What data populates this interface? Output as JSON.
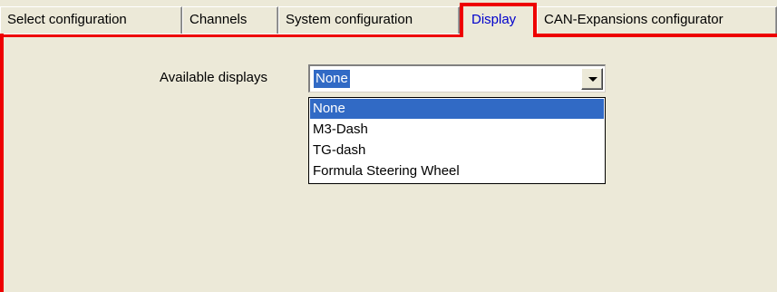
{
  "tabs": [
    {
      "label": "Select configuration",
      "active": false
    },
    {
      "label": "Channels",
      "active": false
    },
    {
      "label": "System configuration",
      "active": false
    },
    {
      "label": "Display",
      "active": true
    },
    {
      "label": "CAN-Expansions configurator",
      "active": false
    }
  ],
  "display_page": {
    "label": "Available displays",
    "select": {
      "value": "None",
      "options": [
        "None",
        "M3-Dash",
        "TG-dash",
        "Formula Steering Wheel"
      ],
      "highlighted_index": 0
    }
  },
  "colors": {
    "active_tab_border": "#ee0000",
    "active_tab_text": "#0000cc",
    "selection": "#316ac5",
    "background": "#ece9d8"
  }
}
